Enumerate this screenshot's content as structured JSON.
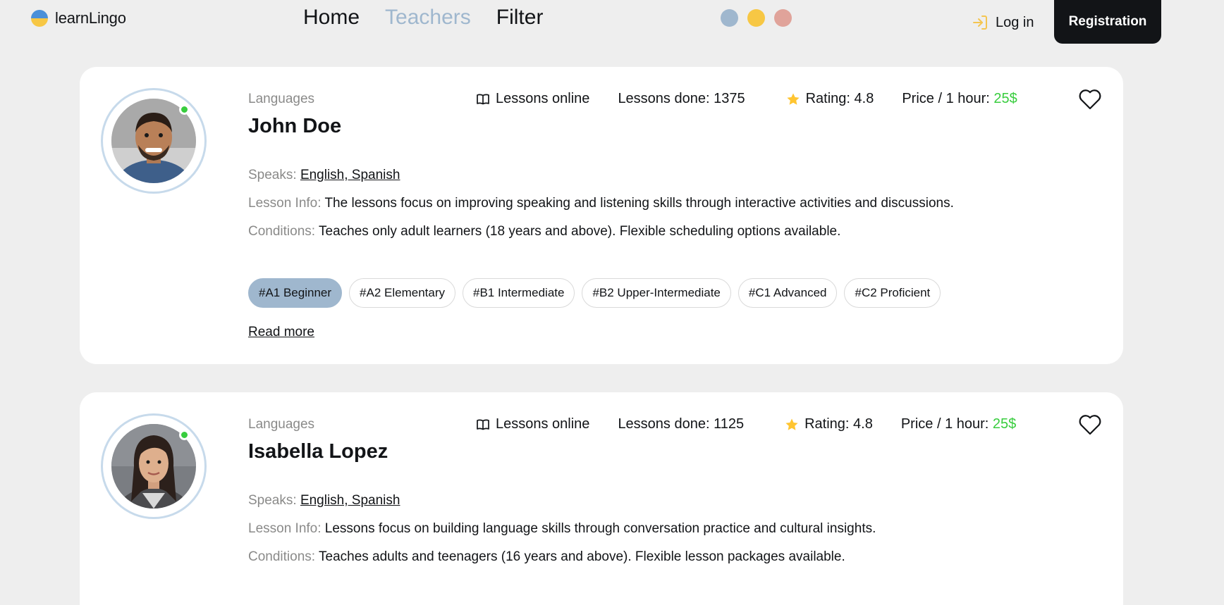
{
  "header": {
    "logo_text": "learnLingo",
    "nav": [
      "Home",
      "Teachers",
      "Filter"
    ],
    "active_nav": "Teachers",
    "theme_colors": [
      "#9fb7ce",
      "#f7c744",
      "#e0a39a"
    ],
    "login_label": "Log in",
    "register_label": "Registration"
  },
  "teachers": [
    {
      "languages_label": "Languages",
      "name": "John Doe",
      "lessons_online": "Lessons online",
      "lessons_done": "Lessons done: 1375",
      "rating": "Rating: 4.8",
      "price_label": "Price / 1 hour: ",
      "price_value": "25$",
      "speaks_label": "Speaks: ",
      "speaks_value": "English, Spanish",
      "lesson_info_label": "Lesson Info: ",
      "lesson_info_value": "The lessons focus on improving speaking and listening skills through interactive activities and discussions.",
      "conditions_label": "Conditions: ",
      "conditions_value": "Teaches only adult learners (18 years and above). Flexible scheduling options available.",
      "levels": [
        "#A1 Beginner",
        "#A2 Elementary",
        "#B1 Intermediate",
        "#B2 Upper-Intermediate",
        "#C1 Advanced",
        "#C2 Proficient"
      ],
      "read_more": "Read more"
    },
    {
      "languages_label": "Languages",
      "name": "Isabella Lopez",
      "lessons_online": "Lessons online",
      "lessons_done": "Lessons done: 1125",
      "rating": "Rating: 4.8",
      "price_label": "Price / 1 hour: ",
      "price_value": "25$",
      "speaks_label": "Speaks: ",
      "speaks_value": "English, Spanish",
      "lesson_info_label": "Lesson Info: ",
      "lesson_info_value": "Lessons focus on building language skills through conversation practice and cultural insights.",
      "conditions_label": "Conditions: ",
      "conditions_value": "Teaches adults and teenagers (16 years and above). Flexible lesson packages available."
    }
  ]
}
